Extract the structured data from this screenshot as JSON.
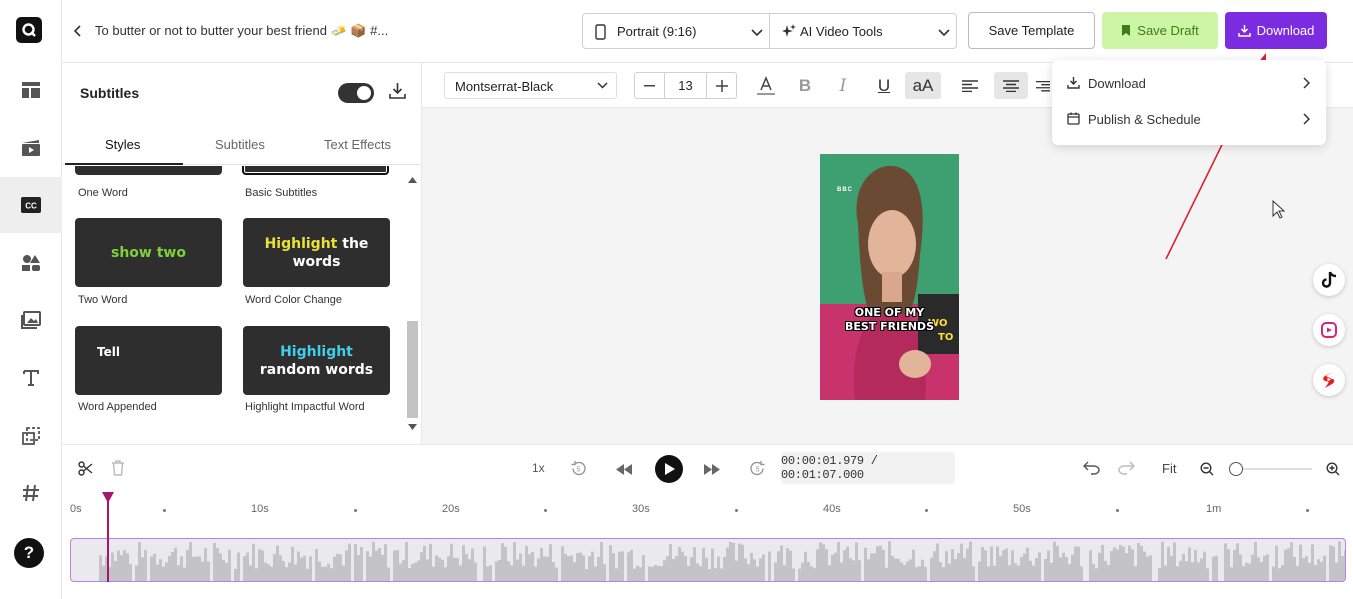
{
  "header": {
    "project_title": "To butter or not to butter your best friend 🧈 📦 #...",
    "aspect_ratio": "Portrait (9:16)",
    "ai_tools": "AI Video Tools",
    "save_template": "Save Template",
    "save_draft": "Save Draft",
    "download": "Download"
  },
  "download_menu": {
    "items": [
      {
        "label": "Download",
        "icon": "download-icon"
      },
      {
        "label": "Publish & Schedule",
        "icon": "calendar-icon"
      }
    ]
  },
  "panel": {
    "title": "Subtitles",
    "toggle_on": true,
    "tabs": [
      "Styles",
      "Subtitles",
      "Text Effects"
    ],
    "active_tab": "Styles",
    "styles": [
      {
        "caption": "One Word"
      },
      {
        "caption": "Basic Subtitles"
      },
      {
        "caption": "Two Word",
        "preview": "show two"
      },
      {
        "caption": "Word Color Change",
        "preview_highlight": "Highlight",
        "preview_rest": " the words"
      },
      {
        "caption": "Word Appended",
        "preview": "Tell"
      },
      {
        "caption": "Highlight Impactful Word",
        "preview_highlight": "Highlight",
        "preview_rest": " random words"
      }
    ]
  },
  "toolbar": {
    "font": "Montserrat-Black",
    "font_size": "13",
    "case_button": "aA"
  },
  "video": {
    "subtitle_line1": "ONE OF MY",
    "subtitle_line2": "BEST FRIENDS",
    "logo": "BBC"
  },
  "timeline": {
    "speed": "1x",
    "time": "00:00:01.979  /  00:01:07.000",
    "fit": "Fit",
    "ruler": [
      "0s",
      "10s",
      "20s",
      "30s",
      "40s",
      "50s",
      "1m"
    ]
  },
  "colors": {
    "accent": "#7c2ce0",
    "draft_bg": "#cdf5a6",
    "draft_text": "#3c7d17",
    "playhead": "#a3186c",
    "highlight_yellow": "#e8e23a",
    "highlight_cyan": "#3ed0e8",
    "two_word_green": "#7fd13b"
  }
}
